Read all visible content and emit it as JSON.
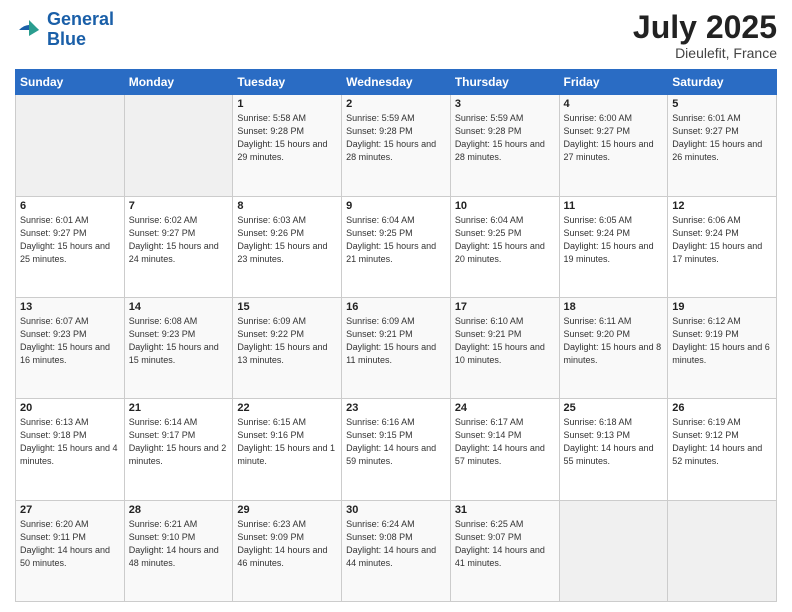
{
  "logo": {
    "line1": "General",
    "line2": "Blue"
  },
  "title": {
    "month_year": "July 2025",
    "location": "Dieulefit, France"
  },
  "days_of_week": [
    "Sunday",
    "Monday",
    "Tuesday",
    "Wednesday",
    "Thursday",
    "Friday",
    "Saturday"
  ],
  "weeks": [
    [
      {
        "day": "",
        "info": ""
      },
      {
        "day": "",
        "info": ""
      },
      {
        "day": "1",
        "info": "Sunrise: 5:58 AM\nSunset: 9:28 PM\nDaylight: 15 hours\nand 29 minutes."
      },
      {
        "day": "2",
        "info": "Sunrise: 5:59 AM\nSunset: 9:28 PM\nDaylight: 15 hours\nand 28 minutes."
      },
      {
        "day": "3",
        "info": "Sunrise: 5:59 AM\nSunset: 9:28 PM\nDaylight: 15 hours\nand 28 minutes."
      },
      {
        "day": "4",
        "info": "Sunrise: 6:00 AM\nSunset: 9:27 PM\nDaylight: 15 hours\nand 27 minutes."
      },
      {
        "day": "5",
        "info": "Sunrise: 6:01 AM\nSunset: 9:27 PM\nDaylight: 15 hours\nand 26 minutes."
      }
    ],
    [
      {
        "day": "6",
        "info": "Sunrise: 6:01 AM\nSunset: 9:27 PM\nDaylight: 15 hours\nand 25 minutes."
      },
      {
        "day": "7",
        "info": "Sunrise: 6:02 AM\nSunset: 9:27 PM\nDaylight: 15 hours\nand 24 minutes."
      },
      {
        "day": "8",
        "info": "Sunrise: 6:03 AM\nSunset: 9:26 PM\nDaylight: 15 hours\nand 23 minutes."
      },
      {
        "day": "9",
        "info": "Sunrise: 6:04 AM\nSunset: 9:25 PM\nDaylight: 15 hours\nand 21 minutes."
      },
      {
        "day": "10",
        "info": "Sunrise: 6:04 AM\nSunset: 9:25 PM\nDaylight: 15 hours\nand 20 minutes."
      },
      {
        "day": "11",
        "info": "Sunrise: 6:05 AM\nSunset: 9:24 PM\nDaylight: 15 hours\nand 19 minutes."
      },
      {
        "day": "12",
        "info": "Sunrise: 6:06 AM\nSunset: 9:24 PM\nDaylight: 15 hours\nand 17 minutes."
      }
    ],
    [
      {
        "day": "13",
        "info": "Sunrise: 6:07 AM\nSunset: 9:23 PM\nDaylight: 15 hours\nand 16 minutes."
      },
      {
        "day": "14",
        "info": "Sunrise: 6:08 AM\nSunset: 9:23 PM\nDaylight: 15 hours\nand 15 minutes."
      },
      {
        "day": "15",
        "info": "Sunrise: 6:09 AM\nSunset: 9:22 PM\nDaylight: 15 hours\nand 13 minutes."
      },
      {
        "day": "16",
        "info": "Sunrise: 6:09 AM\nSunset: 9:21 PM\nDaylight: 15 hours\nand 11 minutes."
      },
      {
        "day": "17",
        "info": "Sunrise: 6:10 AM\nSunset: 9:21 PM\nDaylight: 15 hours\nand 10 minutes."
      },
      {
        "day": "18",
        "info": "Sunrise: 6:11 AM\nSunset: 9:20 PM\nDaylight: 15 hours\nand 8 minutes."
      },
      {
        "day": "19",
        "info": "Sunrise: 6:12 AM\nSunset: 9:19 PM\nDaylight: 15 hours\nand 6 minutes."
      }
    ],
    [
      {
        "day": "20",
        "info": "Sunrise: 6:13 AM\nSunset: 9:18 PM\nDaylight: 15 hours\nand 4 minutes."
      },
      {
        "day": "21",
        "info": "Sunrise: 6:14 AM\nSunset: 9:17 PM\nDaylight: 15 hours\nand 2 minutes."
      },
      {
        "day": "22",
        "info": "Sunrise: 6:15 AM\nSunset: 9:16 PM\nDaylight: 15 hours\nand 1 minute."
      },
      {
        "day": "23",
        "info": "Sunrise: 6:16 AM\nSunset: 9:15 PM\nDaylight: 14 hours\nand 59 minutes."
      },
      {
        "day": "24",
        "info": "Sunrise: 6:17 AM\nSunset: 9:14 PM\nDaylight: 14 hours\nand 57 minutes."
      },
      {
        "day": "25",
        "info": "Sunrise: 6:18 AM\nSunset: 9:13 PM\nDaylight: 14 hours\nand 55 minutes."
      },
      {
        "day": "26",
        "info": "Sunrise: 6:19 AM\nSunset: 9:12 PM\nDaylight: 14 hours\nand 52 minutes."
      }
    ],
    [
      {
        "day": "27",
        "info": "Sunrise: 6:20 AM\nSunset: 9:11 PM\nDaylight: 14 hours\nand 50 minutes."
      },
      {
        "day": "28",
        "info": "Sunrise: 6:21 AM\nSunset: 9:10 PM\nDaylight: 14 hours\nand 48 minutes."
      },
      {
        "day": "29",
        "info": "Sunrise: 6:23 AM\nSunset: 9:09 PM\nDaylight: 14 hours\nand 46 minutes."
      },
      {
        "day": "30",
        "info": "Sunrise: 6:24 AM\nSunset: 9:08 PM\nDaylight: 14 hours\nand 44 minutes."
      },
      {
        "day": "31",
        "info": "Sunrise: 6:25 AM\nSunset: 9:07 PM\nDaylight: 14 hours\nand 41 minutes."
      },
      {
        "day": "",
        "info": ""
      },
      {
        "day": "",
        "info": ""
      }
    ]
  ]
}
